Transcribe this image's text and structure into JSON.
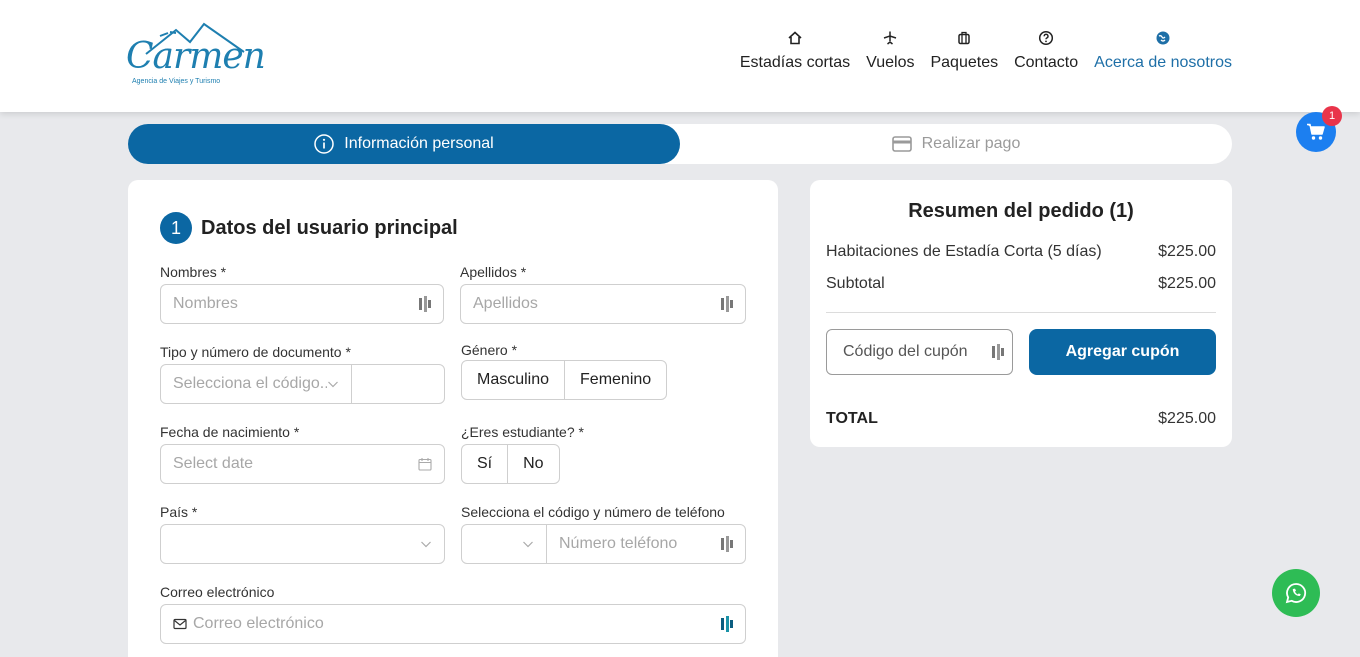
{
  "brand": {
    "name": "Carmen",
    "tagline": "Agencia de Viajes y Turismo",
    "accent": "#0b67a3"
  },
  "nav": [
    {
      "label": "Estadías cortas",
      "icon": "home-icon",
      "active": false
    },
    {
      "label": "Vuelos",
      "icon": "plane-icon",
      "active": false
    },
    {
      "label": "Paquetes",
      "icon": "luggage-icon",
      "active": false
    },
    {
      "label": "Contacto",
      "icon": "question-icon",
      "active": false
    },
    {
      "label": "Acerca de nosotros",
      "icon": "globe-icon",
      "active": true
    }
  ],
  "steps": [
    {
      "label": "Información personal",
      "icon": "info-icon",
      "active": true
    },
    {
      "label": "Realizar pago",
      "icon": "credit-card-icon",
      "active": false
    }
  ],
  "form": {
    "section_number": "1",
    "section_title": "Datos del usuario principal",
    "names_label": "Nombres *",
    "names_placeholder": "Nombres",
    "surnames_label": "Apellidos *",
    "surnames_placeholder": "Apellidos",
    "doc_label": "Tipo y número de documento *",
    "doc_type_placeholder": "Selecciona el código...",
    "gender_label": "Género *",
    "gender_options": [
      "Masculino",
      "Femenino"
    ],
    "birth_label": "Fecha de nacimiento *",
    "birth_placeholder": "Select date",
    "student_label": "¿Eres estudiante? *",
    "student_options": [
      "Sí",
      "No"
    ],
    "country_label": "País *",
    "phone_label": "Selecciona el código y número de teléfono",
    "phone_placeholder": "Número teléfono",
    "email_label": "Correo electrónico",
    "email_placeholder": "Correo electrónico"
  },
  "summary": {
    "title": "Resumen del pedido (1)",
    "items": [
      {
        "label": "Habitaciones de Estadía Corta (5 días)",
        "value": "$225.00"
      },
      {
        "label": "Subtotal",
        "value": "$225.00"
      }
    ],
    "coupon_placeholder": "Código del cupón",
    "coupon_button": "Agregar cupón",
    "total_label": "TOTAL",
    "total_value": "$225.00"
  },
  "cart_count": "1"
}
